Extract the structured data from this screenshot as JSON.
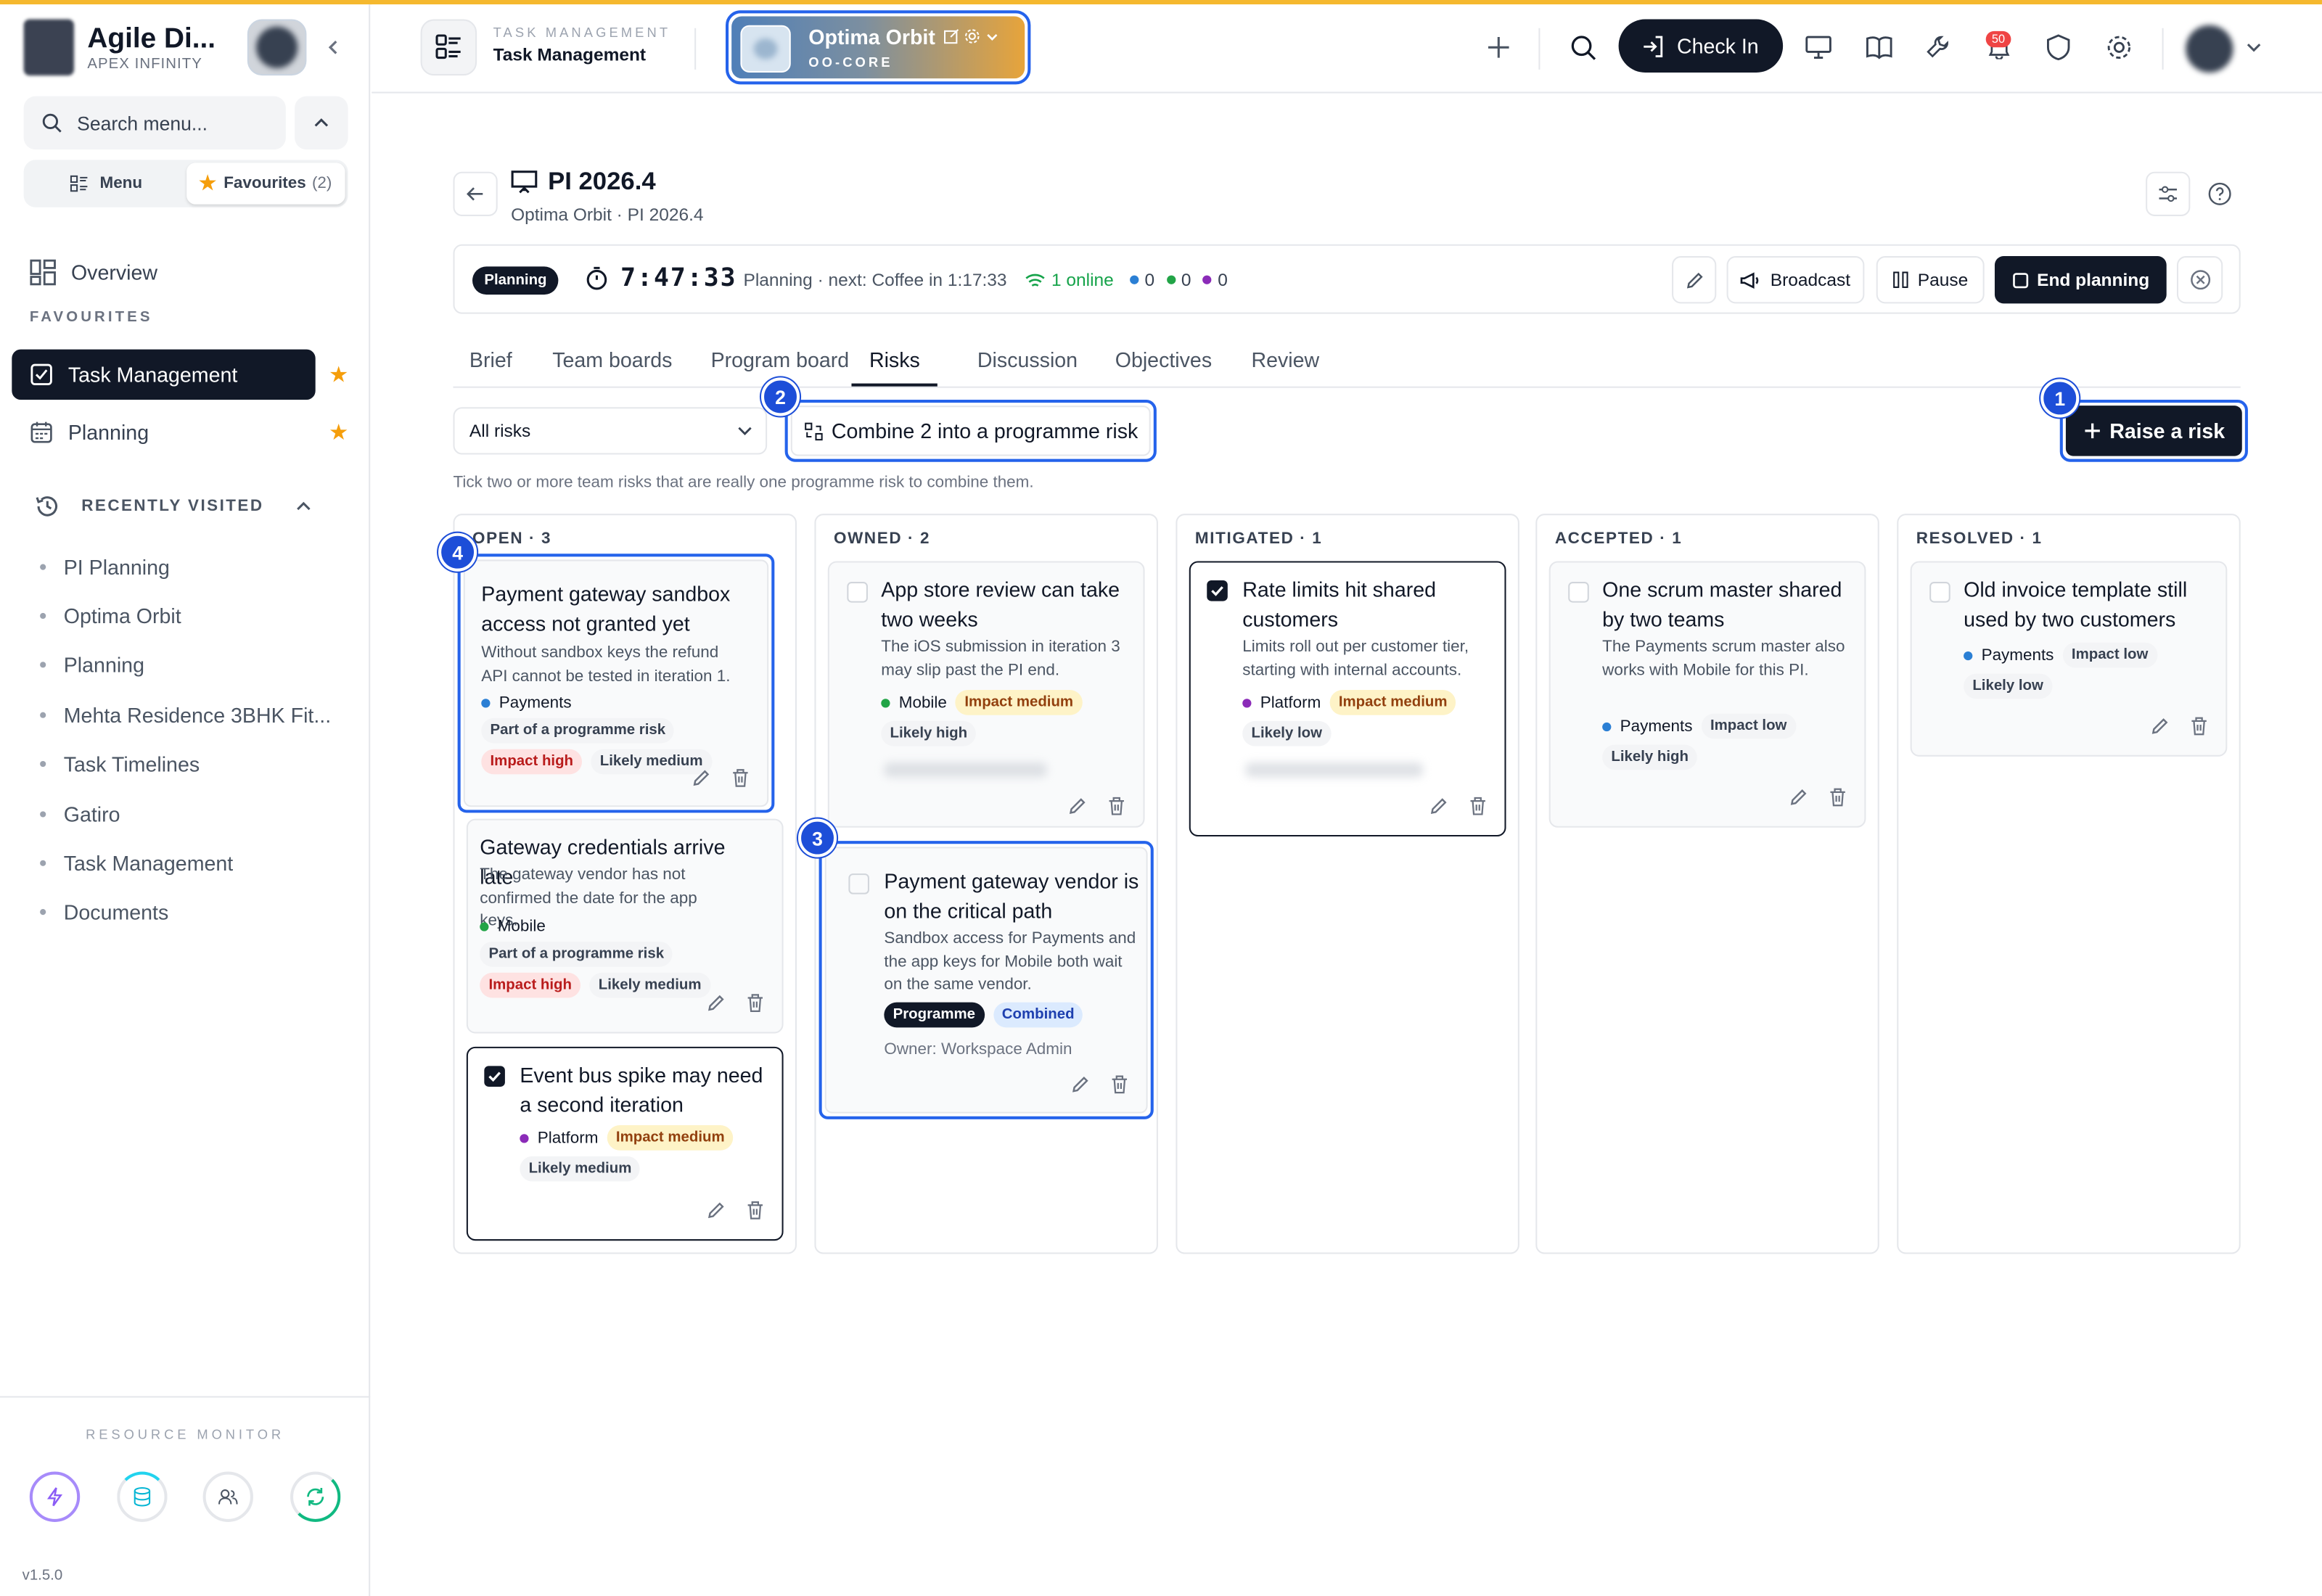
{
  "brand": {
    "name": "Agile Di...",
    "subtitle": "APEX INFINITY"
  },
  "sidebar": {
    "search_placeholder": "Search menu...",
    "tabs": [
      {
        "label": "Menu"
      },
      {
        "label": "Favourites",
        "count": "(2)"
      }
    ],
    "overview": "Overview",
    "favourites_label": "FAVOURITES",
    "favourites": [
      {
        "label": "Task Management",
        "active": true
      },
      {
        "label": "Planning"
      }
    ],
    "recent_label": "RECENTLY VISITED",
    "recent": [
      "PI Planning",
      "Optima Orbit",
      "Planning",
      "Mehta Residence 3BHK Fit...",
      "Task Timelines",
      "Gatiro",
      "Task Management",
      "Documents"
    ],
    "resource_monitor": "RESOURCE MONITOR",
    "version": "v1.5.0"
  },
  "header": {
    "section_sub": "TASK MANAGEMENT",
    "section_title": "Task Management",
    "workspace_name": "Optima Orbit",
    "workspace_code": "OO-CORE",
    "checkin_label": "Check In",
    "notif_count": "50"
  },
  "page": {
    "title": "PI 2026.4",
    "subtitle": "Optima Orbit · PI 2026.4",
    "status_pill": "Planning",
    "timer": "7:47:33",
    "next_label": "Planning · next: Coffee in 1:17:33",
    "online": "1 online",
    "counts": [
      "0",
      "0",
      "0"
    ],
    "broadcast": "Broadcast",
    "pause": "Pause",
    "end_planning": "End planning",
    "tabs": [
      "Brief",
      "Team boards",
      "Program board",
      "Risks",
      "Discussion",
      "Objectives",
      "Review"
    ],
    "active_tab": "Risks",
    "filter_value": "All risks",
    "combine_label": "Combine 2 into a programme risk",
    "raise_label": "Raise a risk",
    "hint": "Tick two or more team risks that are really one programme risk to combine them."
  },
  "markers": [
    "1",
    "2",
    "3",
    "4"
  ],
  "board": {
    "columns": [
      {
        "title": "OPEN · 3"
      },
      {
        "title": "OWNED · 2"
      },
      {
        "title": "MITIGATED · 1"
      },
      {
        "title": "ACCEPTED · 1"
      },
      {
        "title": "RESOLVED · 1"
      }
    ],
    "cards": {
      "open1": {
        "title": "Payment gateway sandbox access not granted yet",
        "desc": "Without sandbox keys the refund API cannot be tested in iteration 1.",
        "team": "Payments",
        "tags": [
          "Part of a programme risk",
          "Impact high",
          "Likely medium"
        ]
      },
      "open2": {
        "title": "Gateway credentials arrive late",
        "desc": "The gateway vendor has not confirmed the date for the app keys.",
        "team": "Mobile",
        "tags": [
          "Part of a programme risk",
          "Impact high",
          "Likely medium"
        ]
      },
      "open3": {
        "title": "Event bus spike may need a second iteration",
        "team": "Platform",
        "tags": [
          "Impact medium",
          "Likely medium"
        ]
      },
      "owned1": {
        "title": "App store review can take two weeks",
        "desc": "The iOS submission in iteration 3 may slip past the PI end.",
        "team": "Mobile",
        "tags": [
          "Impact medium",
          "Likely high"
        ]
      },
      "owned2": {
        "title": "Payment gateway vendor is on the critical path",
        "desc": "Sandbox access for Payments and the app keys for Mobile both wait on the same vendor.",
        "tags": [
          "Programme",
          "Combined"
        ],
        "owner": "Owner: Workspace Admin"
      },
      "mitigated1": {
        "title": "Rate limits hit shared customers",
        "desc": "Limits roll out per customer tier, starting with internal accounts.",
        "team": "Platform",
        "tags": [
          "Impact medium",
          "Likely low"
        ]
      },
      "accepted1": {
        "title": "One scrum master shared by two teams",
        "desc": "The Payments scrum master also works with Mobile for this PI.",
        "team": "Payments",
        "tags": [
          "Impact low",
          "Likely high"
        ]
      },
      "resolved1": {
        "title": "Old invoice template still used by two customers",
        "team": "Payments",
        "tags": [
          "Impact low",
          "Likely low"
        ]
      }
    }
  },
  "colors": {
    "accent": "#2563eb",
    "dark": "#111827",
    "topline": "#f5b82e",
    "payments": "#2b7fd4",
    "mobile": "#22a447",
    "platform": "#8b2bb8"
  }
}
